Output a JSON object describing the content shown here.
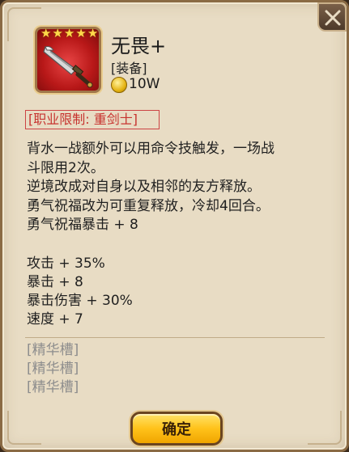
{
  "item": {
    "name": "无畏+",
    "type": "[装备]",
    "price": "10W",
    "stars": 5,
    "icon": "broad-sword-icon",
    "frame_color": "#c41e1e"
  },
  "restriction": "[职业限制: 重剑士]",
  "description": [
    "背水一战额外可以用命令技触发，一场战",
    "斗限用2次。",
    "逆境改成对自身以及相邻的友方释放。",
    "勇气祝福改为可重复释放，冷却4回合。",
    "勇气祝福暴击 + 8"
  ],
  "stats": [
    "攻击 + 35%",
    "暴击 + 8",
    "暴击伤害 + 30%",
    "速度 + 7"
  ],
  "slots": [
    "[精华槽]",
    "[精华槽]",
    "[精华槽]"
  ],
  "buttons": {
    "confirm": "确定"
  },
  "colors": {
    "restriction": "#c7332f",
    "slot_text": "#8d8d8d",
    "button": "#ffc21a"
  }
}
